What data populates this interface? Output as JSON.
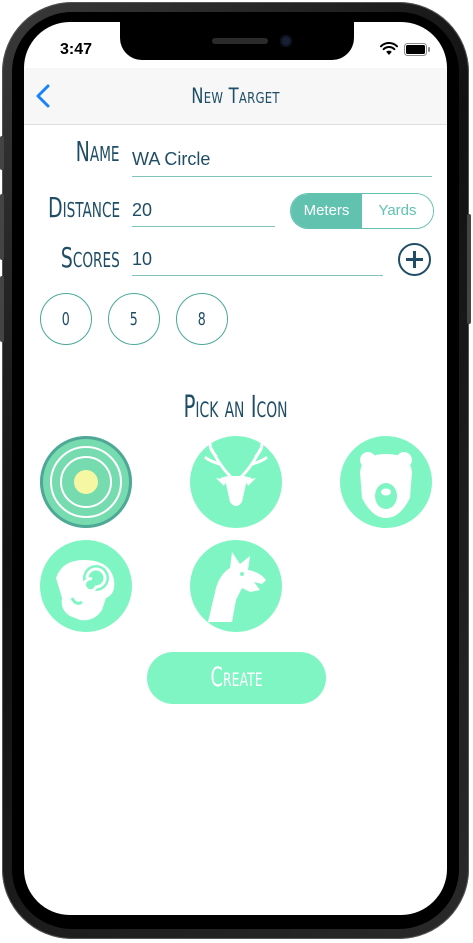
{
  "status_bar": {
    "time": "3:47"
  },
  "nav": {
    "title": "New Target"
  },
  "form": {
    "name_label": "Name",
    "name_value": "WA Circle",
    "distance_label": "Distance",
    "distance_value": "20",
    "unit_options": [
      "Meters",
      "Yards"
    ],
    "unit_selected": "Meters",
    "scores_label": "Scores",
    "scores_value": "10",
    "scores": [
      "0",
      "5",
      "8"
    ]
  },
  "icons": {
    "title": "Pick an Icon",
    "items": [
      "target-icon",
      "deer-icon",
      "bear-icon",
      "ram-icon",
      "wolf-icon"
    ],
    "selected": "target-icon"
  },
  "create_label": "Create",
  "colors": {
    "accent": "#61c2b0",
    "mint": "#7ff5c3",
    "title_navy": "#1f4d66",
    "ios_blue": "#1a82f7"
  }
}
